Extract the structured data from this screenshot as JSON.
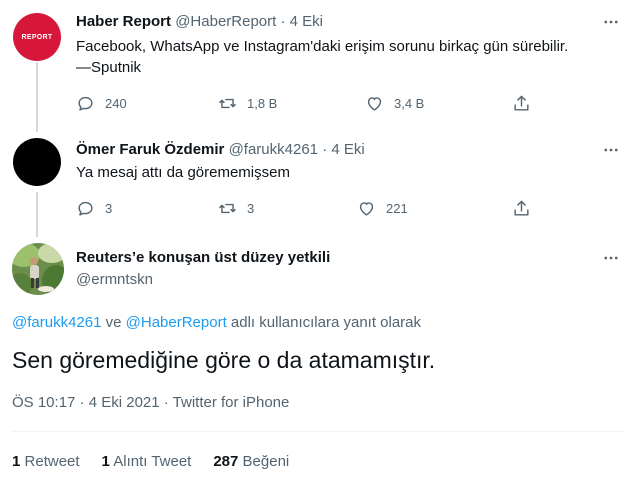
{
  "tweets": [
    {
      "name": "Haber Report",
      "handle": "@HaberReport",
      "sep": "·",
      "time": "4 Eki",
      "avatar_text": "REPORT",
      "text": "Facebook, WhatsApp ve Instagram'daki erişim sorunu birkaç gün sürebilir.\n—Sputnik",
      "replies": "240",
      "retweets": "1,8 B",
      "likes": "3,4 B"
    },
    {
      "name": "Ömer Faruk Özdemir",
      "handle": "@farukk4261",
      "sep": "·",
      "time": "4 Eki",
      "text": "Ya mesaj attı da görememişsem",
      "replies": "3",
      "retweets": "3",
      "likes": "221"
    }
  ],
  "main": {
    "name": "Reuters’e konuşan üst düzey yetkili",
    "handle": "@ermntskn",
    "reply_link_1": "@farukk4261",
    "reply_and": " ve ",
    "reply_link_2": "@HaberReport",
    "reply_suffix": " adlı kullanıcılara yanıt olarak",
    "text": "Sen göremediğine göre o da atamamıştır.",
    "meta": "ÖS 10:17 · 4 Eki 2021 · Twitter for iPhone",
    "stats": [
      {
        "count": "1",
        "label": "Retweet"
      },
      {
        "count": "1",
        "label": "Alıntı Tweet"
      },
      {
        "count": "287",
        "label": "Beğeni"
      }
    ]
  },
  "colors": {
    "accent": "#1d9bf0",
    "brand_red": "#d6173a",
    "secondary_text": "#536471"
  },
  "icons": [
    "more-icon",
    "reply-icon",
    "retweet-icon",
    "like-icon",
    "share-icon"
  ]
}
